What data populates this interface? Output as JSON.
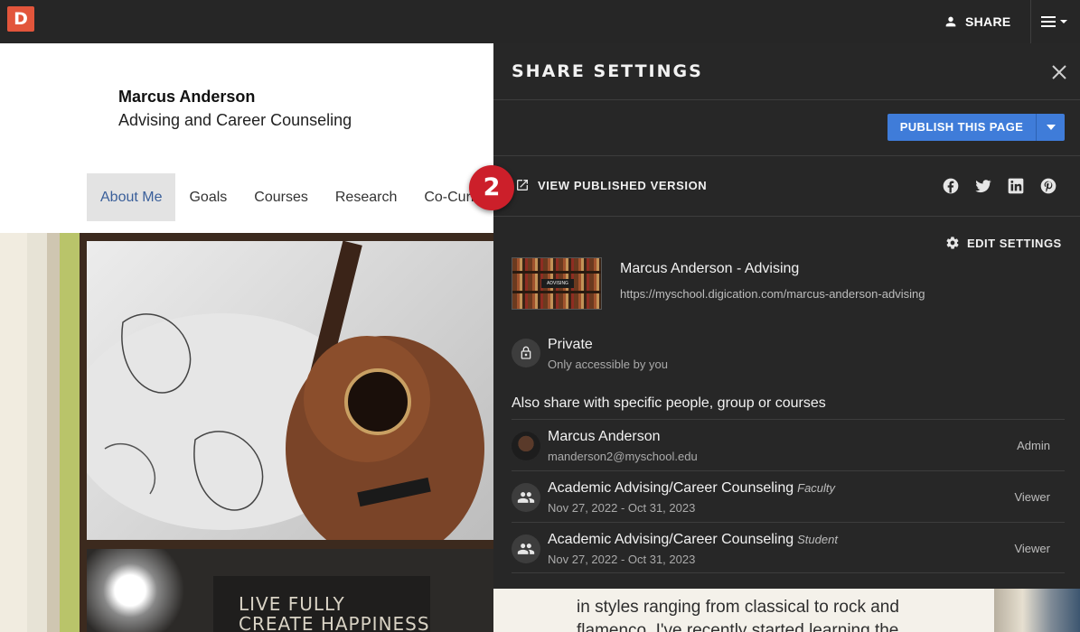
{
  "topbar": {
    "logo": "D",
    "share_label": "SHARE"
  },
  "page": {
    "author": "Marcus Anderson",
    "subtitle": "Advising and Career Counseling",
    "nav": [
      "About Me",
      "Goals",
      "Courses",
      "Research",
      "Co-Curr"
    ],
    "photo2_text": [
      "LIVE FULLY",
      "CREATE HAPPINESS"
    ],
    "body_text": [
      "in styles ranging from classical to rock and",
      "flamenco. I've recently started learning the"
    ]
  },
  "panel": {
    "title": "SHARE SETTINGS",
    "publish_label": "PUBLISH THIS PAGE",
    "step_badge": "2",
    "view_published_label": "VIEW PUBLISHED VERSION",
    "social_icons": [
      "facebook-icon",
      "twitter-icon",
      "linkedin-icon",
      "pinterest-icon"
    ],
    "edit_settings_label": "EDIT SETTINGS",
    "thumb_label": "ADVISING",
    "site_title": "Marcus Anderson - Advising",
    "site_url": "https://myschool.digication.com/marcus-anderson-advising",
    "privacy": {
      "title": "Private",
      "subtitle": "Only accessible by you"
    },
    "also_share_label": "Also share with specific people, group or courses",
    "members": [
      {
        "name": "Marcus Anderson",
        "tag": "",
        "sub": "manderson2@myschool.edu",
        "role": "Admin"
      },
      {
        "name": "Academic Advising/Career Counseling",
        "tag": "Faculty",
        "sub": "Nov 27, 2022 - Oct 31, 2023",
        "role": "Viewer"
      },
      {
        "name": "Academic Advising/Career Counseling",
        "tag": "Student",
        "sub": "Nov 27, 2022 - Oct 31, 2023",
        "role": "Viewer"
      }
    ]
  },
  "colors": {
    "accent": "#3f7cd9",
    "badge": "#cc1f2a",
    "logo": "#e2553b",
    "panel": "#272727"
  }
}
